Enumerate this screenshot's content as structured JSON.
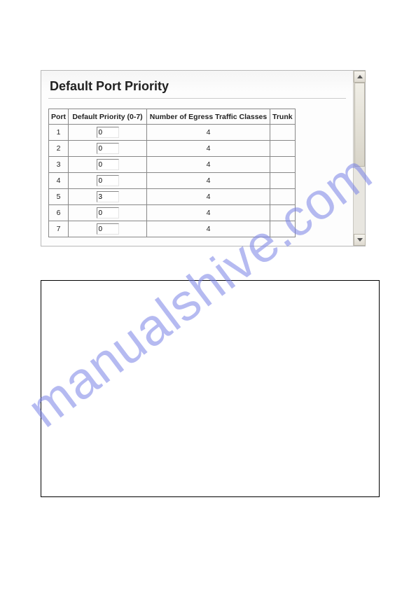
{
  "watermark": "manualshive.com",
  "panel": {
    "title": "Default Port Priority",
    "columns": {
      "port": "Port",
      "priority": "Default Priority (0-7)",
      "egress": "Number of Egress Traffic Classes",
      "trunk": "Trunk"
    },
    "rows": [
      {
        "port": "1",
        "priority": "0",
        "egress": "4",
        "trunk": ""
      },
      {
        "port": "2",
        "priority": "0",
        "egress": "4",
        "trunk": ""
      },
      {
        "port": "3",
        "priority": "0",
        "egress": "4",
        "trunk": ""
      },
      {
        "port": "4",
        "priority": "0",
        "egress": "4",
        "trunk": ""
      },
      {
        "port": "5",
        "priority": "3",
        "egress": "4",
        "trunk": ""
      },
      {
        "port": "6",
        "priority": "0",
        "egress": "4",
        "trunk": ""
      },
      {
        "port": "7",
        "priority": "0",
        "egress": "4",
        "trunk": ""
      }
    ]
  }
}
